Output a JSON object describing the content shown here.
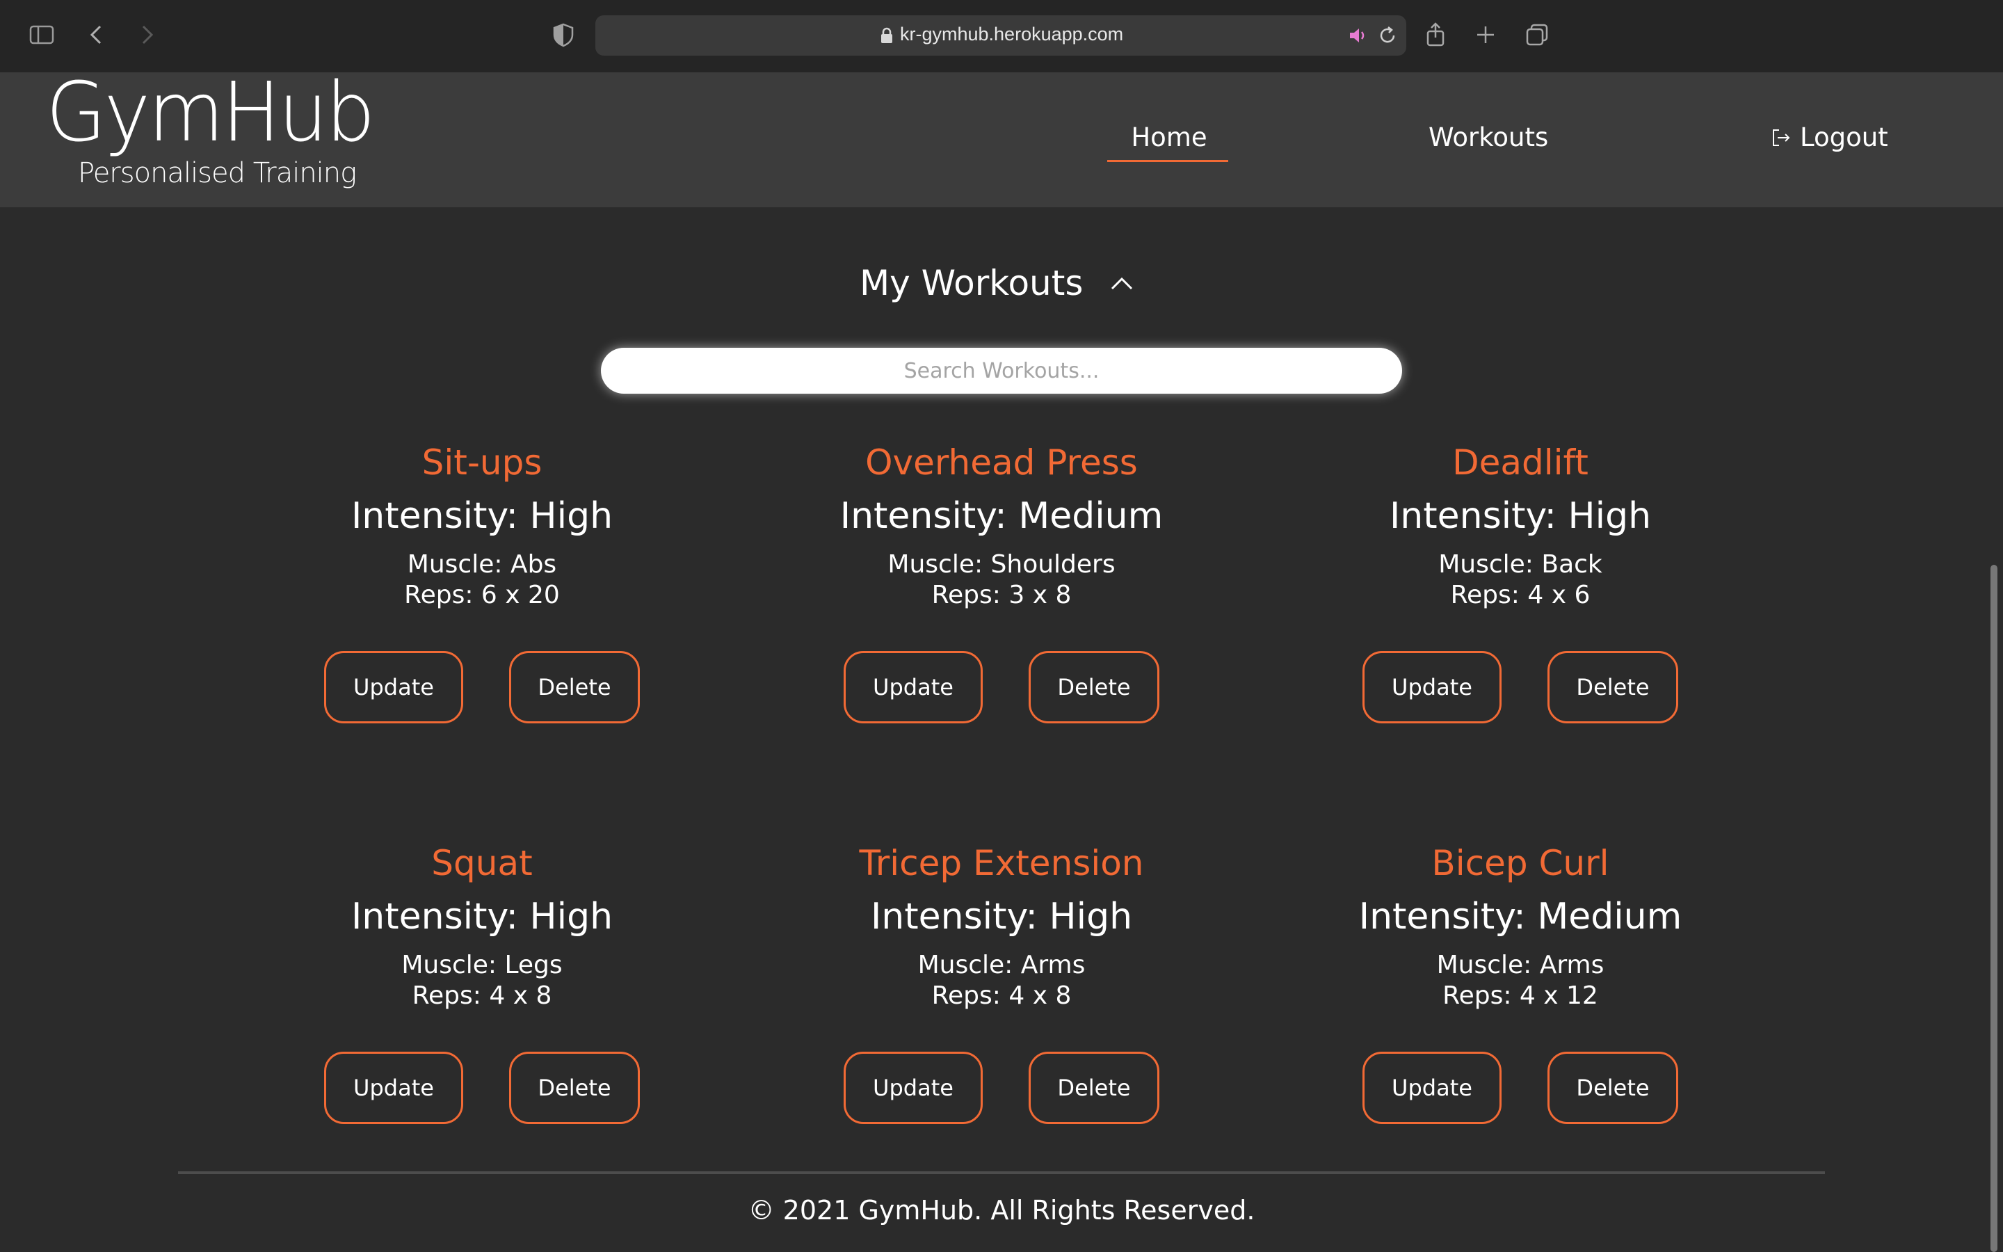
{
  "browser": {
    "url": "kr-gymhub.herokuapp.com",
    "icons": [
      "sidebar-icon",
      "back-icon",
      "forward-icon",
      "shield-icon",
      "lock-icon",
      "audio-icon",
      "reload-icon",
      "share-icon",
      "new-tab-icon",
      "tabs-icon"
    ]
  },
  "header": {
    "logo_title": "GymHub",
    "logo_subtitle": "Personalised Training",
    "nav": {
      "home": "Home",
      "workouts": "Workouts",
      "logout": "Logout"
    }
  },
  "main": {
    "section_title": "My Workouts",
    "search_placeholder": "Search Workouts...",
    "update_label": "Update",
    "delete_label": "Delete",
    "workouts": [
      {
        "name": "Sit-ups",
        "intensity": "Intensity: High",
        "muscle": "Muscle: Abs",
        "reps": "Reps: 6 x 20"
      },
      {
        "name": "Overhead Press",
        "intensity": "Intensity: Medium",
        "muscle": "Muscle: Shoulders",
        "reps": "Reps: 3 x 8"
      },
      {
        "name": "Deadlift",
        "intensity": "Intensity: High",
        "muscle": "Muscle: Back",
        "reps": "Reps: 4 x 6"
      },
      {
        "name": "Squat",
        "intensity": "Intensity: High",
        "muscle": "Muscle: Legs",
        "reps": "Reps: 4 x 8"
      },
      {
        "name": "Tricep Extension",
        "intensity": "Intensity: High",
        "muscle": "Muscle: Arms",
        "reps": "Reps: 4 x 8"
      },
      {
        "name": "Bicep Curl",
        "intensity": "Intensity: Medium",
        "muscle": "Muscle: Arms",
        "reps": "Reps: 4 x 12"
      }
    ]
  },
  "footer": {
    "text": "© 2021 GymHub. All Rights Reserved."
  },
  "colors": {
    "accent": "#f26a35",
    "background": "#2b2b2b",
    "header_bg": "#3c3c3c"
  }
}
